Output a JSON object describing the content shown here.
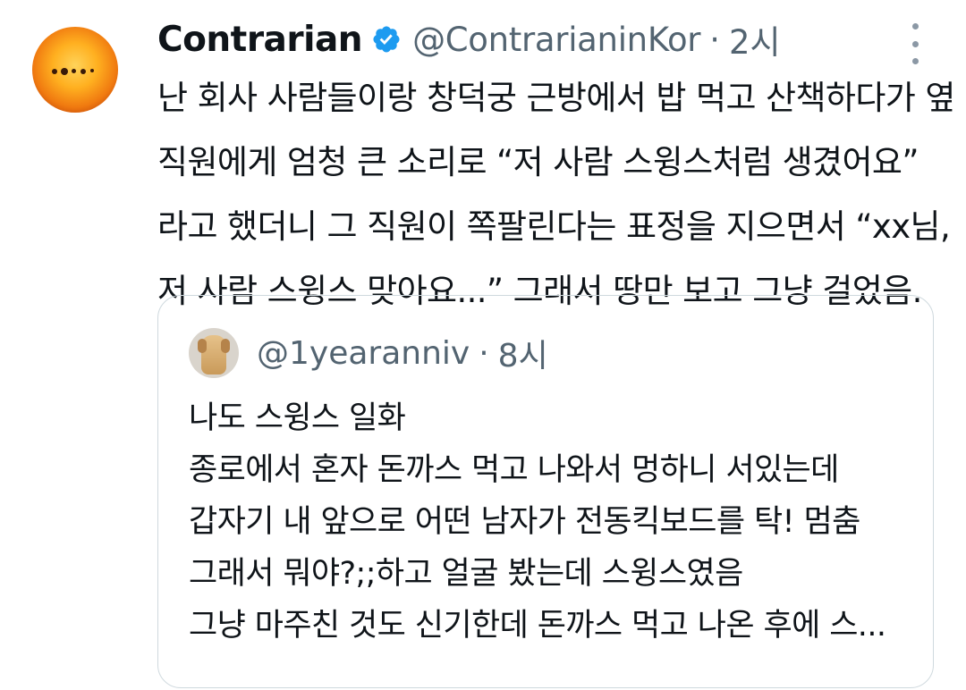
{
  "tweet": {
    "display_name": "Contrarian",
    "handle": "@ContrarianinKor",
    "separator": "·",
    "time": "2시",
    "lines": [
      "난 회사 사람들이랑 창덕궁 근방에서 밥 먹고 산책하다가 옆",
      "직원에게 엄청 큰 소리로 “저 사람 스윙스처럼 생겼어요”",
      "라고 했더니 그 직원이 쪽팔린다는 표정을 지으면서 “xx님,",
      "저 사람 스윙스 맞아요...” 그래서 땅만 보고 그냥 걸었음."
    ]
  },
  "quoted": {
    "handle": "@1yearanniv",
    "separator": "·",
    "time": "8시",
    "lines": [
      "나도 스윙스 일화",
      "종로에서 혼자 돈까스 먹고 나와서 멍하니 서있는데",
      "갑자기 내 앞으로 어떤 남자가 전동킥보드를 탁! 멈춤",
      "그래서 뭐야?;;하고 얼굴 봤는데 스윙스였음",
      "그냥 마주친 것도 신기한데 돈까스 먹고 나온 후에 스..."
    ]
  },
  "icons": {
    "verified": "verified-badge-icon",
    "more": "more-vertical-icon"
  },
  "colors": {
    "verified_blue": "#1d9bf0",
    "secondary_text": "#536471",
    "border": "#cfd9de"
  }
}
